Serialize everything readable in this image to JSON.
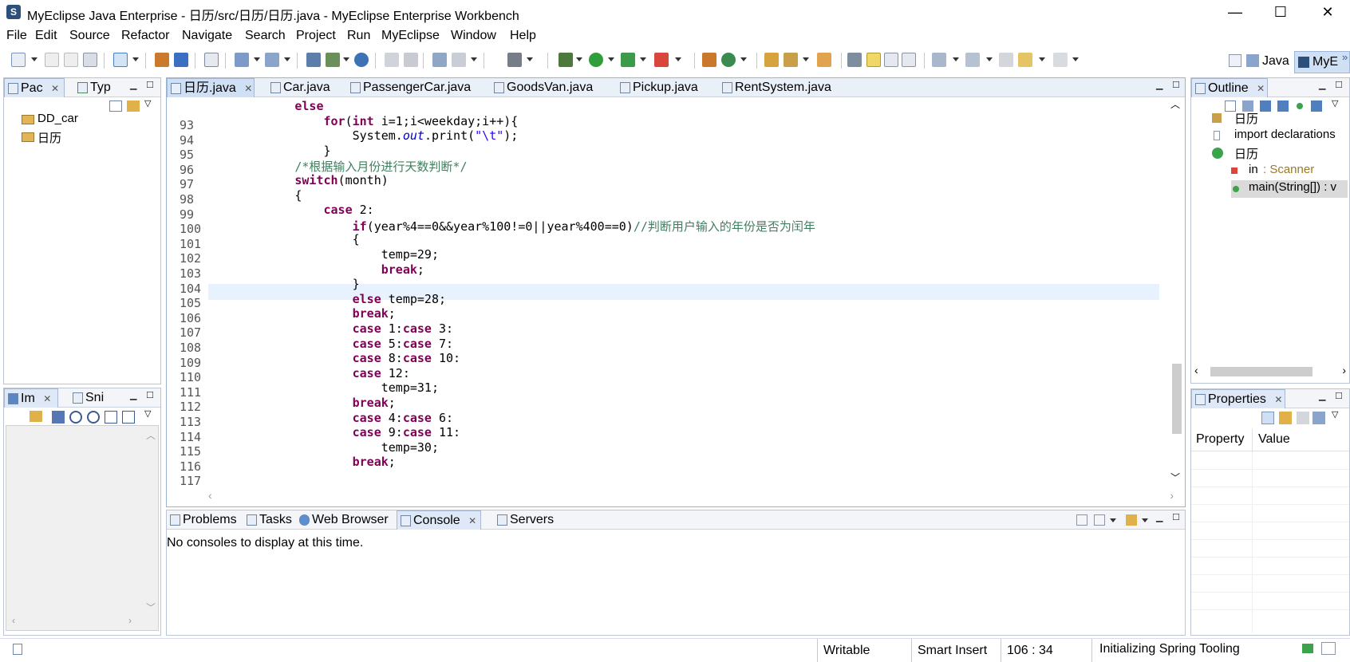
{
  "window": {
    "title": "MyEclipse Java Enterprise - 日历/src/日历/日历.java - MyEclipse Enterprise Workbench",
    "min_glyph": "—",
    "max_glyph": "☐",
    "close_glyph": "✕"
  },
  "menu": [
    "File",
    "Edit",
    "Source",
    "Refactor",
    "Navigate",
    "Search",
    "Project",
    "Run",
    "MyEclipse",
    "Window",
    "Help"
  ],
  "perspectives": {
    "java": "Java",
    "myeclipse": "MyE",
    "more": "»"
  },
  "package_explorer": {
    "tabs": [
      "Pac",
      "Typ"
    ],
    "items": [
      "DD_car",
      "日历"
    ]
  },
  "image_view": {
    "tabs": [
      "Im",
      "Sni"
    ]
  },
  "editor": {
    "tabs": [
      "日历.java",
      "Car.java",
      "PassengerCar.java",
      "GoodsVan.java",
      "Pickup.java",
      "RentSystem.java"
    ],
    "lines": [
      {
        "n": "93",
        "parts": [
          [
            "kw",
            "            else"
          ]
        ]
      },
      {
        "n": "94",
        "parts": [
          [
            "kw",
            "                for"
          ],
          [
            "",
            "("
          ],
          [
            "kw",
            "int"
          ],
          [
            "",
            " i=1;i<weekday;i++){"
          ]
        ]
      },
      {
        "n": "95",
        "parts": [
          [
            "",
            "                    System."
          ],
          [
            "it",
            "out"
          ],
          [
            "",
            ".print("
          ],
          [
            "st",
            "\"\\t\""
          ],
          [
            "",
            ");"
          ]
        ]
      },
      {
        "n": "96",
        "parts": [
          [
            "",
            "                }"
          ]
        ]
      },
      {
        "n": "97",
        "parts": [
          [
            "cm",
            "            /*根据输入月份进行天数判断*/"
          ]
        ]
      },
      {
        "n": "98",
        "parts": [
          [
            "kw",
            "            switch"
          ],
          [
            "",
            "(month)"
          ]
        ]
      },
      {
        "n": "99",
        "parts": [
          [
            "",
            "            {"
          ]
        ]
      },
      {
        "n": "100",
        "parts": [
          [
            "kw",
            "                case"
          ],
          [
            "",
            " 2:"
          ]
        ]
      },
      {
        "n": "101",
        "parts": [
          [
            "kw",
            "                    if"
          ],
          [
            "",
            "(year%4==0&&year%100!=0||year%400==0)"
          ],
          [
            "cm",
            "//判断用户输入的年份是否为闰年"
          ]
        ]
      },
      {
        "n": "102",
        "parts": [
          [
            "",
            "                    {"
          ]
        ]
      },
      {
        "n": "103",
        "parts": [
          [
            "",
            "                        temp=29;"
          ]
        ]
      },
      {
        "n": "104",
        "parts": [
          [
            "kw",
            "                        break"
          ],
          [
            "",
            ";"
          ]
        ]
      },
      {
        "n": "105",
        "parts": [
          [
            "",
            "                    }"
          ]
        ]
      },
      {
        "n": "106",
        "parts": [
          [
            "kw",
            "                    else"
          ],
          [
            "",
            " temp=28;"
          ]
        ]
      },
      {
        "n": "107",
        "parts": [
          [
            "kw",
            "                    break"
          ],
          [
            "",
            ";"
          ]
        ]
      },
      {
        "n": "108",
        "parts": [
          [
            "kw",
            "                    case"
          ],
          [
            "",
            " 1:"
          ],
          [
            "kw",
            "case"
          ],
          [
            "",
            " 3:"
          ]
        ]
      },
      {
        "n": "109",
        "parts": [
          [
            "kw",
            "                    case"
          ],
          [
            "",
            " 5:"
          ],
          [
            "kw",
            "case"
          ],
          [
            "",
            " 7:"
          ]
        ]
      },
      {
        "n": "110",
        "parts": [
          [
            "kw",
            "                    case"
          ],
          [
            "",
            " 8:"
          ],
          [
            "kw",
            "case"
          ],
          [
            "",
            " 10:"
          ]
        ]
      },
      {
        "n": "111",
        "parts": [
          [
            "kw",
            "                    case"
          ],
          [
            "",
            " 12:"
          ]
        ]
      },
      {
        "n": "112",
        "parts": [
          [
            "",
            "                        temp=31;"
          ]
        ]
      },
      {
        "n": "113",
        "parts": [
          [
            "kw",
            "                    break"
          ],
          [
            "",
            ";"
          ]
        ]
      },
      {
        "n": "114",
        "parts": [
          [
            "kw",
            "                    case"
          ],
          [
            "",
            " 4:"
          ],
          [
            "kw",
            "case"
          ],
          [
            "",
            " 6:"
          ]
        ]
      },
      {
        "n": "115",
        "parts": [
          [
            "kw",
            "                    case"
          ],
          [
            "",
            " 9:"
          ],
          [
            "kw",
            "case"
          ],
          [
            "",
            " 11:"
          ]
        ]
      },
      {
        "n": "116",
        "parts": [
          [
            "",
            "                        temp=30;"
          ]
        ]
      },
      {
        "n": "117",
        "parts": [
          [
            "kw",
            "                    break"
          ],
          [
            "",
            ";"
          ]
        ]
      }
    ]
  },
  "console": {
    "tabs": [
      "Problems",
      "Tasks",
      "Web Browser",
      "Console",
      "Servers"
    ],
    "message": "No consoles to display at this time."
  },
  "outline": {
    "tab": "Outline",
    "items": [
      "日历",
      "import declarations",
      "日历",
      "in",
      ": Scanner",
      "main(String[]) : v"
    ]
  },
  "properties": {
    "tab": "Properties",
    "col_property": "Property",
    "col_value": "Value"
  },
  "status": {
    "writable": "Writable",
    "insert": "Smart Insert",
    "position": "106 : 34",
    "task": "Initializing Spring Tooling"
  }
}
